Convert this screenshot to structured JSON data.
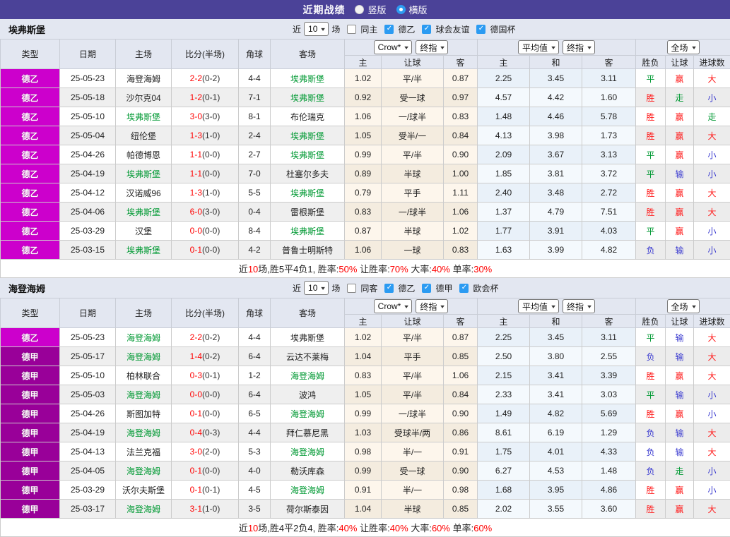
{
  "banner": {
    "title": "近期战绩",
    "options": [
      {
        "label": "竖版",
        "selected": false
      },
      {
        "label": "横版",
        "selected": true
      }
    ]
  },
  "colors": {
    "banner_bg": "#4b4298",
    "league": {
      "德乙": "#cc00cc",
      "德甲": "#990099"
    },
    "result": {
      "r": "#ff1a1a",
      "g": "#009933",
      "b": "#3838cf"
    },
    "checkbox_on": "#2b9bf2",
    "team_highlight": "#009933",
    "score_red": "#ff0000"
  },
  "header_labels": {
    "left": [
      "类型",
      "日期",
      "主场",
      "比分(半场)",
      "角球",
      "客场"
    ],
    "sub": [
      "主",
      "让球",
      "客",
      "主",
      "和",
      "客",
      "胜负",
      "让球",
      "进球数"
    ]
  },
  "tables": [
    {
      "team": "埃弗斯堡",
      "filter": {
        "prefix": "近",
        "count": "10",
        "suffix": "场",
        "same": {
          "label": "同主",
          "checked": false
        },
        "comps": [
          {
            "label": "德乙",
            "checked": true
          },
          {
            "label": "球会友谊",
            "checked": true
          },
          {
            "label": "德国杯",
            "checked": true
          }
        ]
      },
      "dropdowns": {
        "group1": [
          "Crow*",
          "终指"
        ],
        "group2": [
          "平均值",
          "终指"
        ],
        "group3": [
          "全场"
        ]
      },
      "rows": [
        {
          "league": "德乙",
          "date": "25-05-23",
          "home": "海登海姆",
          "home_active": false,
          "score": "2-2",
          "half": "(0-2)",
          "corners": "4-4",
          "away": "埃弗斯堡",
          "away_active": true,
          "crow_home": "1.02",
          "handicap": "平/半",
          "crow_away": "0.87",
          "avg_home": "2.25",
          "avg_draw": "3.45",
          "avg_away": "3.11",
          "result": "平",
          "result_c": "g",
          "cover": "赢",
          "cover_c": "r",
          "goals": "大",
          "goals_c": "r"
        },
        {
          "league": "德乙",
          "date": "25-05-18",
          "home": "沙尔克04",
          "home_active": false,
          "score": "1-2",
          "half": "(0-1)",
          "corners": "7-1",
          "away": "埃弗斯堡",
          "away_active": true,
          "crow_home": "0.92",
          "handicap": "受一球",
          "crow_away": "0.97",
          "avg_home": "4.57",
          "avg_draw": "4.42",
          "avg_away": "1.60",
          "result": "胜",
          "result_c": "r",
          "cover": "走",
          "cover_c": "g",
          "goals": "小",
          "goals_c": "b"
        },
        {
          "league": "德乙",
          "date": "25-05-10",
          "home": "埃弗斯堡",
          "home_active": true,
          "score": "3-0",
          "half": "(3-0)",
          "corners": "8-1",
          "away": "布伦瑞克",
          "away_active": false,
          "crow_home": "1.06",
          "handicap": "一/球半",
          "crow_away": "0.83",
          "avg_home": "1.48",
          "avg_draw": "4.46",
          "avg_away": "5.78",
          "result": "胜",
          "result_c": "r",
          "cover": "赢",
          "cover_c": "r",
          "goals": "走",
          "goals_c": "g"
        },
        {
          "league": "德乙",
          "date": "25-05-04",
          "home": "纽伦堡",
          "home_active": false,
          "score": "1-3",
          "half": "(1-0)",
          "corners": "2-4",
          "away": "埃弗斯堡",
          "away_active": true,
          "crow_home": "1.05",
          "handicap": "受半/一",
          "crow_away": "0.84",
          "avg_home": "4.13",
          "avg_draw": "3.98",
          "avg_away": "1.73",
          "result": "胜",
          "result_c": "r",
          "cover": "赢",
          "cover_c": "r",
          "goals": "大",
          "goals_c": "r"
        },
        {
          "league": "德乙",
          "date": "25-04-26",
          "home": "帕德博恩",
          "home_active": false,
          "score": "1-1",
          "half": "(0-0)",
          "corners": "2-7",
          "away": "埃弗斯堡",
          "away_active": true,
          "crow_home": "0.99",
          "handicap": "平/半",
          "crow_away": "0.90",
          "avg_home": "2.09",
          "avg_draw": "3.67",
          "avg_away": "3.13",
          "result": "平",
          "result_c": "g",
          "cover": "赢",
          "cover_c": "r",
          "goals": "小",
          "goals_c": "b"
        },
        {
          "league": "德乙",
          "date": "25-04-19",
          "home": "埃弗斯堡",
          "home_active": true,
          "score": "1-1",
          "half": "(0-0)",
          "corners": "7-0",
          "away": "杜塞尔多夫",
          "away_active": false,
          "crow_home": "0.89",
          "handicap": "半球",
          "crow_away": "1.00",
          "avg_home": "1.85",
          "avg_draw": "3.81",
          "avg_away": "3.72",
          "result": "平",
          "result_c": "g",
          "cover": "输",
          "cover_c": "b",
          "goals": "小",
          "goals_c": "b"
        },
        {
          "league": "德乙",
          "date": "25-04-12",
          "home": "汉诺威96",
          "home_active": false,
          "score": "1-3",
          "half": "(1-0)",
          "corners": "5-5",
          "away": "埃弗斯堡",
          "away_active": true,
          "crow_home": "0.79",
          "handicap": "平手",
          "crow_away": "1.11",
          "avg_home": "2.40",
          "avg_draw": "3.48",
          "avg_away": "2.72",
          "result": "胜",
          "result_c": "r",
          "cover": "赢",
          "cover_c": "r",
          "goals": "大",
          "goals_c": "r"
        },
        {
          "league": "德乙",
          "date": "25-04-06",
          "home": "埃弗斯堡",
          "home_active": true,
          "score": "6-0",
          "half": "(3-0)",
          "corners": "0-4",
          "away": "雷根斯堡",
          "away_active": false,
          "crow_home": "0.83",
          "handicap": "一/球半",
          "crow_away": "1.06",
          "avg_home": "1.37",
          "avg_draw": "4.79",
          "avg_away": "7.51",
          "result": "胜",
          "result_c": "r",
          "cover": "赢",
          "cover_c": "r",
          "goals": "大",
          "goals_c": "r"
        },
        {
          "league": "德乙",
          "date": "25-03-29",
          "home": "汉堡",
          "home_active": false,
          "score": "0-0",
          "half": "(0-0)",
          "corners": "8-4",
          "away": "埃弗斯堡",
          "away_active": true,
          "crow_home": "0.87",
          "handicap": "半球",
          "crow_away": "1.02",
          "avg_home": "1.77",
          "avg_draw": "3.91",
          "avg_away": "4.03",
          "result": "平",
          "result_c": "g",
          "cover": "赢",
          "cover_c": "r",
          "goals": "小",
          "goals_c": "b"
        },
        {
          "league": "德乙",
          "date": "25-03-15",
          "home": "埃弗斯堡",
          "home_active": true,
          "score": "0-1",
          "half": "(0-0)",
          "corners": "4-2",
          "away": "普鲁士明斯特",
          "away_active": false,
          "crow_home": "1.06",
          "handicap": "一球",
          "crow_away": "0.83",
          "avg_home": "1.63",
          "avg_draw": "3.99",
          "avg_away": "4.82",
          "result": "负",
          "result_c": "b",
          "cover": "输",
          "cover_c": "b",
          "goals": "小",
          "goals_c": "b"
        }
      ],
      "summary": [
        {
          "text": "近",
          "red": false
        },
        {
          "text": "10",
          "red": true
        },
        {
          "text": "场,胜5平4负1, 胜率:",
          "red": false
        },
        {
          "text": "50%",
          "red": true
        },
        {
          "text": " 让胜率:",
          "red": false
        },
        {
          "text": "70%",
          "red": true
        },
        {
          "text": " 大率:",
          "red": false
        },
        {
          "text": "40%",
          "red": true
        },
        {
          "text": " 单率:",
          "red": false
        },
        {
          "text": "30%",
          "red": true
        }
      ]
    },
    {
      "team": "海登海姆",
      "filter": {
        "prefix": "近",
        "count": "10",
        "suffix": "场",
        "same": {
          "label": "同客",
          "checked": false
        },
        "comps": [
          {
            "label": "德乙",
            "checked": true
          },
          {
            "label": "德甲",
            "checked": true
          },
          {
            "label": "欧会杯",
            "checked": true
          }
        ]
      },
      "dropdowns": {
        "group1": [
          "Crow*",
          "终指"
        ],
        "group2": [
          "平均值",
          "终指"
        ],
        "group3": [
          "全场"
        ]
      },
      "rows": [
        {
          "league": "德乙",
          "date": "25-05-23",
          "home": "海登海姆",
          "home_active": true,
          "score": "2-2",
          "half": "(0-2)",
          "corners": "4-4",
          "away": "埃弗斯堡",
          "away_active": false,
          "crow_home": "1.02",
          "handicap": "平/半",
          "crow_away": "0.87",
          "avg_home": "2.25",
          "avg_draw": "3.45",
          "avg_away": "3.11",
          "result": "平",
          "result_c": "g",
          "cover": "输",
          "cover_c": "b",
          "goals": "大",
          "goals_c": "r"
        },
        {
          "league": "德甲",
          "date": "25-05-17",
          "home": "海登海姆",
          "home_active": true,
          "score": "1-4",
          "half": "(0-2)",
          "corners": "6-4",
          "away": "云达不莱梅",
          "away_active": false,
          "crow_home": "1.04",
          "handicap": "平手",
          "crow_away": "0.85",
          "avg_home": "2.50",
          "avg_draw": "3.80",
          "avg_away": "2.55",
          "result": "负",
          "result_c": "b",
          "cover": "输",
          "cover_c": "b",
          "goals": "大",
          "goals_c": "r"
        },
        {
          "league": "德甲",
          "date": "25-05-10",
          "home": "柏林联合",
          "home_active": false,
          "score": "0-3",
          "half": "(0-1)",
          "corners": "1-2",
          "away": "海登海姆",
          "away_active": true,
          "crow_home": "0.83",
          "handicap": "平/半",
          "crow_away": "1.06",
          "avg_home": "2.15",
          "avg_draw": "3.41",
          "avg_away": "3.39",
          "result": "胜",
          "result_c": "r",
          "cover": "赢",
          "cover_c": "r",
          "goals": "大",
          "goals_c": "r"
        },
        {
          "league": "德甲",
          "date": "25-05-03",
          "home": "海登海姆",
          "home_active": true,
          "score": "0-0",
          "half": "(0-0)",
          "corners": "6-4",
          "away": "波鸿",
          "away_active": false,
          "crow_home": "1.05",
          "handicap": "平/半",
          "crow_away": "0.84",
          "avg_home": "2.33",
          "avg_draw": "3.41",
          "avg_away": "3.03",
          "result": "平",
          "result_c": "g",
          "cover": "输",
          "cover_c": "b",
          "goals": "小",
          "goals_c": "b"
        },
        {
          "league": "德甲",
          "date": "25-04-26",
          "home": "斯图加特",
          "home_active": false,
          "score": "0-1",
          "half": "(0-0)",
          "corners": "6-5",
          "away": "海登海姆",
          "away_active": true,
          "crow_home": "0.99",
          "handicap": "一/球半",
          "crow_away": "0.90",
          "avg_home": "1.49",
          "avg_draw": "4.82",
          "avg_away": "5.69",
          "result": "胜",
          "result_c": "r",
          "cover": "赢",
          "cover_c": "r",
          "goals": "小",
          "goals_c": "b"
        },
        {
          "league": "德甲",
          "date": "25-04-19",
          "home": "海登海姆",
          "home_active": true,
          "score": "0-4",
          "half": "(0-3)",
          "corners": "4-4",
          "away": "拜仁慕尼黑",
          "away_active": false,
          "crow_home": "1.03",
          "handicap": "受球半/两",
          "crow_away": "0.86",
          "avg_home": "8.61",
          "avg_draw": "6.19",
          "avg_away": "1.29",
          "result": "负",
          "result_c": "b",
          "cover": "输",
          "cover_c": "b",
          "goals": "大",
          "goals_c": "r"
        },
        {
          "league": "德甲",
          "date": "25-04-13",
          "home": "法兰克福",
          "home_active": false,
          "score": "3-0",
          "half": "(2-0)",
          "corners": "5-3",
          "away": "海登海姆",
          "away_active": true,
          "crow_home": "0.98",
          "handicap": "半/一",
          "crow_away": "0.91",
          "avg_home": "1.75",
          "avg_draw": "4.01",
          "avg_away": "4.33",
          "result": "负",
          "result_c": "b",
          "cover": "输",
          "cover_c": "b",
          "goals": "大",
          "goals_c": "r"
        },
        {
          "league": "德甲",
          "date": "25-04-05",
          "home": "海登海姆",
          "home_active": true,
          "score": "0-1",
          "half": "(0-0)",
          "corners": "4-0",
          "away": "勒沃库森",
          "away_active": false,
          "crow_home": "0.99",
          "handicap": "受一球",
          "crow_away": "0.90",
          "avg_home": "6.27",
          "avg_draw": "4.53",
          "avg_away": "1.48",
          "result": "负",
          "result_c": "b",
          "cover": "走",
          "cover_c": "g",
          "goals": "小",
          "goals_c": "b"
        },
        {
          "league": "德甲",
          "date": "25-03-29",
          "home": "沃尔夫斯堡",
          "home_active": false,
          "score": "0-1",
          "half": "(0-1)",
          "corners": "4-5",
          "away": "海登海姆",
          "away_active": true,
          "crow_home": "0.91",
          "handicap": "半/一",
          "crow_away": "0.98",
          "avg_home": "1.68",
          "avg_draw": "3.95",
          "avg_away": "4.86",
          "result": "胜",
          "result_c": "r",
          "cover": "赢",
          "cover_c": "r",
          "goals": "小",
          "goals_c": "b"
        },
        {
          "league": "德甲",
          "date": "25-03-17",
          "home": "海登海姆",
          "home_active": true,
          "score": "3-1",
          "half": "(1-0)",
          "corners": "3-5",
          "away": "荷尔斯泰因",
          "away_active": false,
          "crow_home": "1.04",
          "handicap": "半球",
          "crow_away": "0.85",
          "avg_home": "2.02",
          "avg_draw": "3.55",
          "avg_away": "3.60",
          "result": "胜",
          "result_c": "r",
          "cover": "赢",
          "cover_c": "r",
          "goals": "大",
          "goals_c": "r"
        }
      ],
      "summary": [
        {
          "text": "近",
          "red": false
        },
        {
          "text": "10",
          "red": true
        },
        {
          "text": "场,胜4平2负4, 胜率:",
          "red": false
        },
        {
          "text": "40%",
          "red": true
        },
        {
          "text": " 让胜率:",
          "red": false
        },
        {
          "text": "40%",
          "red": true
        },
        {
          "text": " 大率:",
          "red": false
        },
        {
          "text": "60%",
          "red": true
        },
        {
          "text": " 单率:",
          "red": false
        },
        {
          "text": "60%",
          "red": true
        }
      ]
    }
  ]
}
